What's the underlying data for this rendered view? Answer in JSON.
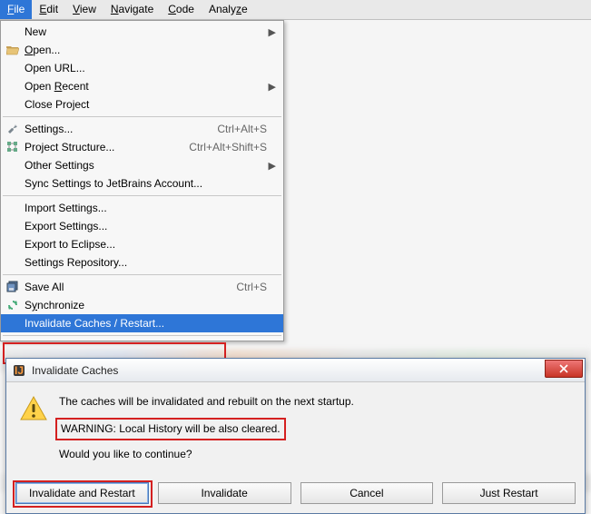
{
  "menubar": {
    "items": [
      {
        "label": "File",
        "hotkey": "F",
        "active": true
      },
      {
        "label": "Edit",
        "hotkey": "E"
      },
      {
        "label": "View",
        "hotkey": "V"
      },
      {
        "label": "Navigate",
        "hotkey": "N"
      },
      {
        "label": "Code",
        "hotkey": "C"
      },
      {
        "label": "Analyze",
        "hotkey": "z"
      }
    ]
  },
  "file_menu": {
    "new": "New",
    "open": "Open...",
    "open_url": "Open URL...",
    "open_recent": "Open Recent",
    "close_project": "Close Project",
    "settings": "Settings...",
    "settings_sc": "Ctrl+Alt+S",
    "project_structure": "Project Structure...",
    "project_structure_sc": "Ctrl+Alt+Shift+S",
    "other_settings": "Other Settings",
    "sync_settings": "Sync Settings to JetBrains Account...",
    "import_settings": "Import Settings...",
    "export_settings": "Export Settings...",
    "export_eclipse": "Export to Eclipse...",
    "settings_repo": "Settings Repository...",
    "save_all": "Save All",
    "save_all_sc": "Ctrl+S",
    "synchronize": "Synchronize",
    "invalidate": "Invalidate Caches / Restart..."
  },
  "dialog": {
    "title": "Invalidate Caches",
    "line1": "The caches will be invalidated and rebuilt on the next startup.",
    "warning": "WARNING: Local History will be also cleared.",
    "line3": "Would you like to continue?",
    "btn_invalidate_restart": "Invalidate and Restart",
    "btn_invalidate": "Invalidate",
    "btn_cancel": "Cancel",
    "btn_just_restart": "Just Restart"
  }
}
